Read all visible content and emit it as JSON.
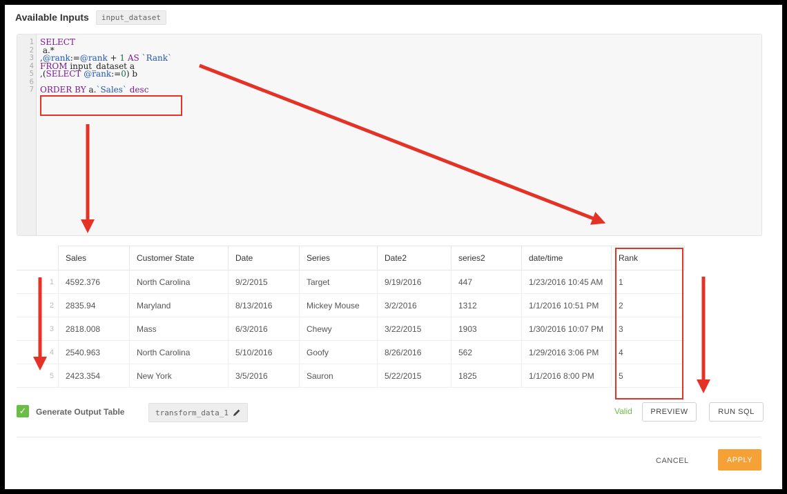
{
  "header": {
    "title": "Available Inputs",
    "input_chip": "input_dataset"
  },
  "editor": {
    "line_numbers": [
      "1",
      "2",
      "3",
      "4",
      "5",
      "6",
      "7"
    ],
    "lines": {
      "l1_kw": "SELECT",
      "l2": " a.*",
      "l3_a": ",",
      "l3_var1": "@rank",
      "l3_b": ":=",
      "l3_var2": "@rank",
      "l3_c": " + ",
      "l3_num": "1",
      "l3_d": " ",
      "l3_kw": "AS",
      "l3_e": " ",
      "l3_bt": "`Rank`",
      "l4_kw": "FROM",
      "l4_rest": " input_dataset a",
      "l5_a": ",(",
      "l5_kw": "SELECT",
      "l5_b": " ",
      "l5_var": "@rank",
      "l5_c": ":=",
      "l5_num": "0",
      "l5_d": ") b",
      "l7_kw": "ORDER BY",
      "l7_a": " a.",
      "l7_bt": "`Sales`",
      "l7_b": " ",
      "l7_kw2": "desc"
    }
  },
  "table": {
    "columns": [
      "Sales",
      "Customer State",
      "Date",
      "Series",
      "Date2",
      "series2",
      "date/time",
      "Rank"
    ],
    "rows": [
      [
        "1",
        "4592.376",
        "North Carolina",
        "9/2/2015",
        "Target",
        "9/19/2016",
        "447",
        "1/23/2016 10:45 AM",
        "1"
      ],
      [
        "2",
        "2835.94",
        "Maryland",
        "8/13/2016",
        "Mickey Mouse",
        "3/2/2016",
        "1312",
        "1/1/2016 10:51 PM",
        "2"
      ],
      [
        "3",
        "2818.008",
        "Mass",
        "6/3/2016",
        "Chewy",
        "3/22/2015",
        "1903",
        "1/30/2016 10:07 PM",
        "3"
      ],
      [
        "4",
        "2540.963",
        "North Carolina",
        "5/10/2016",
        "Goofy",
        "8/26/2016",
        "562",
        "1/29/2016 3:06 PM",
        "4"
      ],
      [
        "5",
        "2423.354",
        "New York",
        "3/5/2016",
        "Sauron",
        "5/22/2015",
        "1825",
        "1/1/2016 8:00 PM",
        "5"
      ]
    ]
  },
  "footer": {
    "generate_label": "Generate Output Table",
    "generate_checked": true,
    "output_name": "transform_data_1",
    "status": "Valid",
    "preview_label": "PREVIEW",
    "run_label": "RUN SQL",
    "cancel_label": "CANCEL",
    "apply_label": "APPLY"
  },
  "colors": {
    "accent": "#f5a135",
    "valid": "#6cbd45",
    "annotation": "#e53226"
  },
  "icons": {
    "check": "check-icon",
    "edit": "pencil-icon"
  }
}
